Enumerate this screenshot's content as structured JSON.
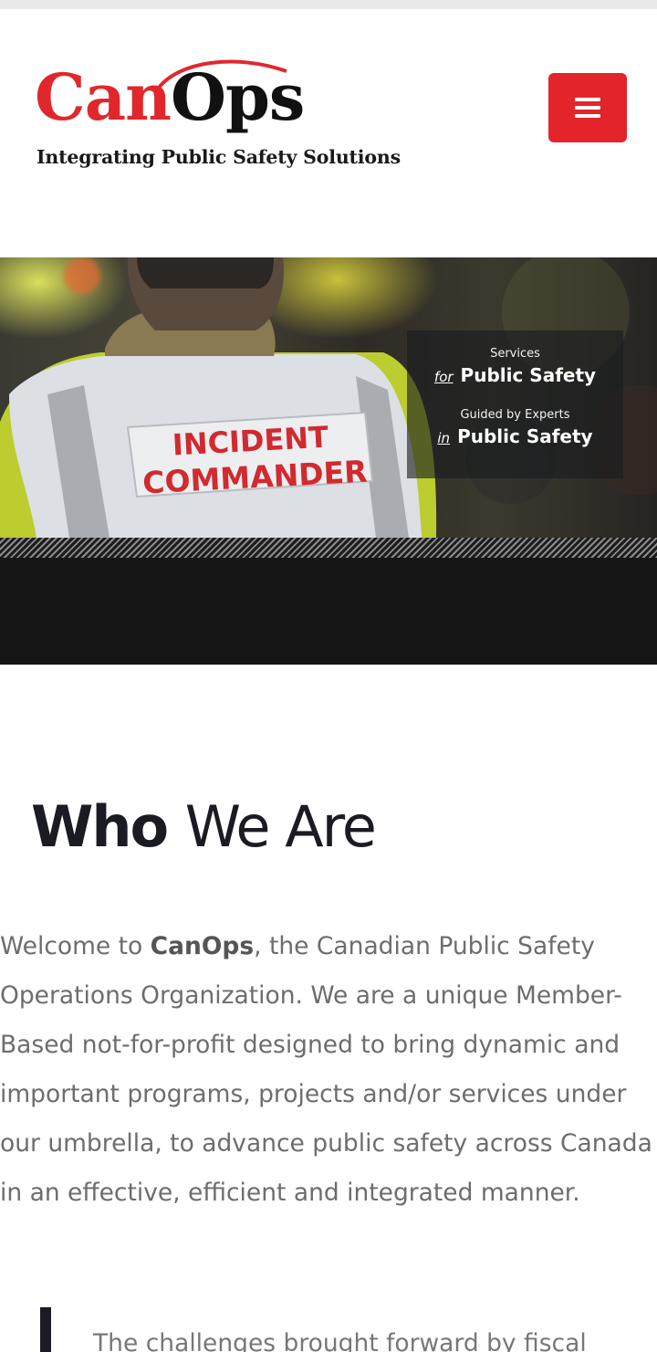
{
  "brand": {
    "logo_can": "Can",
    "logo_ops": "Ops",
    "tagline": "Integrating Public Safety Solutions",
    "primary_color": "#e3242b"
  },
  "header": {
    "menu_icon": "hamburger-menu-icon"
  },
  "hero": {
    "vest_line1": "INCIDENT",
    "vest_line2": "COMMANDER",
    "overlay": {
      "line1_small": "Services",
      "line1_prep": "for",
      "line1_big": "Public Safety",
      "line2_small": "Guided by Experts",
      "line2_prep": "in",
      "line2_big": "Public Safety"
    }
  },
  "who": {
    "title_bold": "Who",
    "title_light": "We Are",
    "intro_before": "Welcome to ",
    "intro_brand": "CanOps",
    "intro_after": ", the Canadian Public Safety Operations Organization. We are a unique Member-Based not-for-profit designed to bring dynamic and important programs, projects and/or services under our umbrella, to advance public safety across Canada in an effective, efficient and integrated manner.",
    "quote_partial": "The challenges brought forward by fiscal"
  }
}
